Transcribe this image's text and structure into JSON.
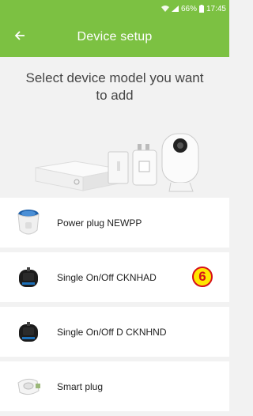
{
  "status": {
    "battery": "66%",
    "time": "17:45"
  },
  "header": {
    "title": "Device setup"
  },
  "prompt": "Select device model you want to add",
  "devices": [
    {
      "label": "Power plug NEWPP",
      "icon": "power-plug-icon"
    },
    {
      "label": "Single On/Off CKNHAD",
      "icon": "relay-module-icon",
      "badge": "6"
    },
    {
      "label": "Single On/Off D CKNHND",
      "icon": "relay-module-icon"
    },
    {
      "label": "Smart plug",
      "icon": "smart-plug-icon"
    }
  ],
  "colors": {
    "accent": "#7cc142",
    "badge_fill": "#ffe600",
    "badge_border": "#d6101a"
  }
}
